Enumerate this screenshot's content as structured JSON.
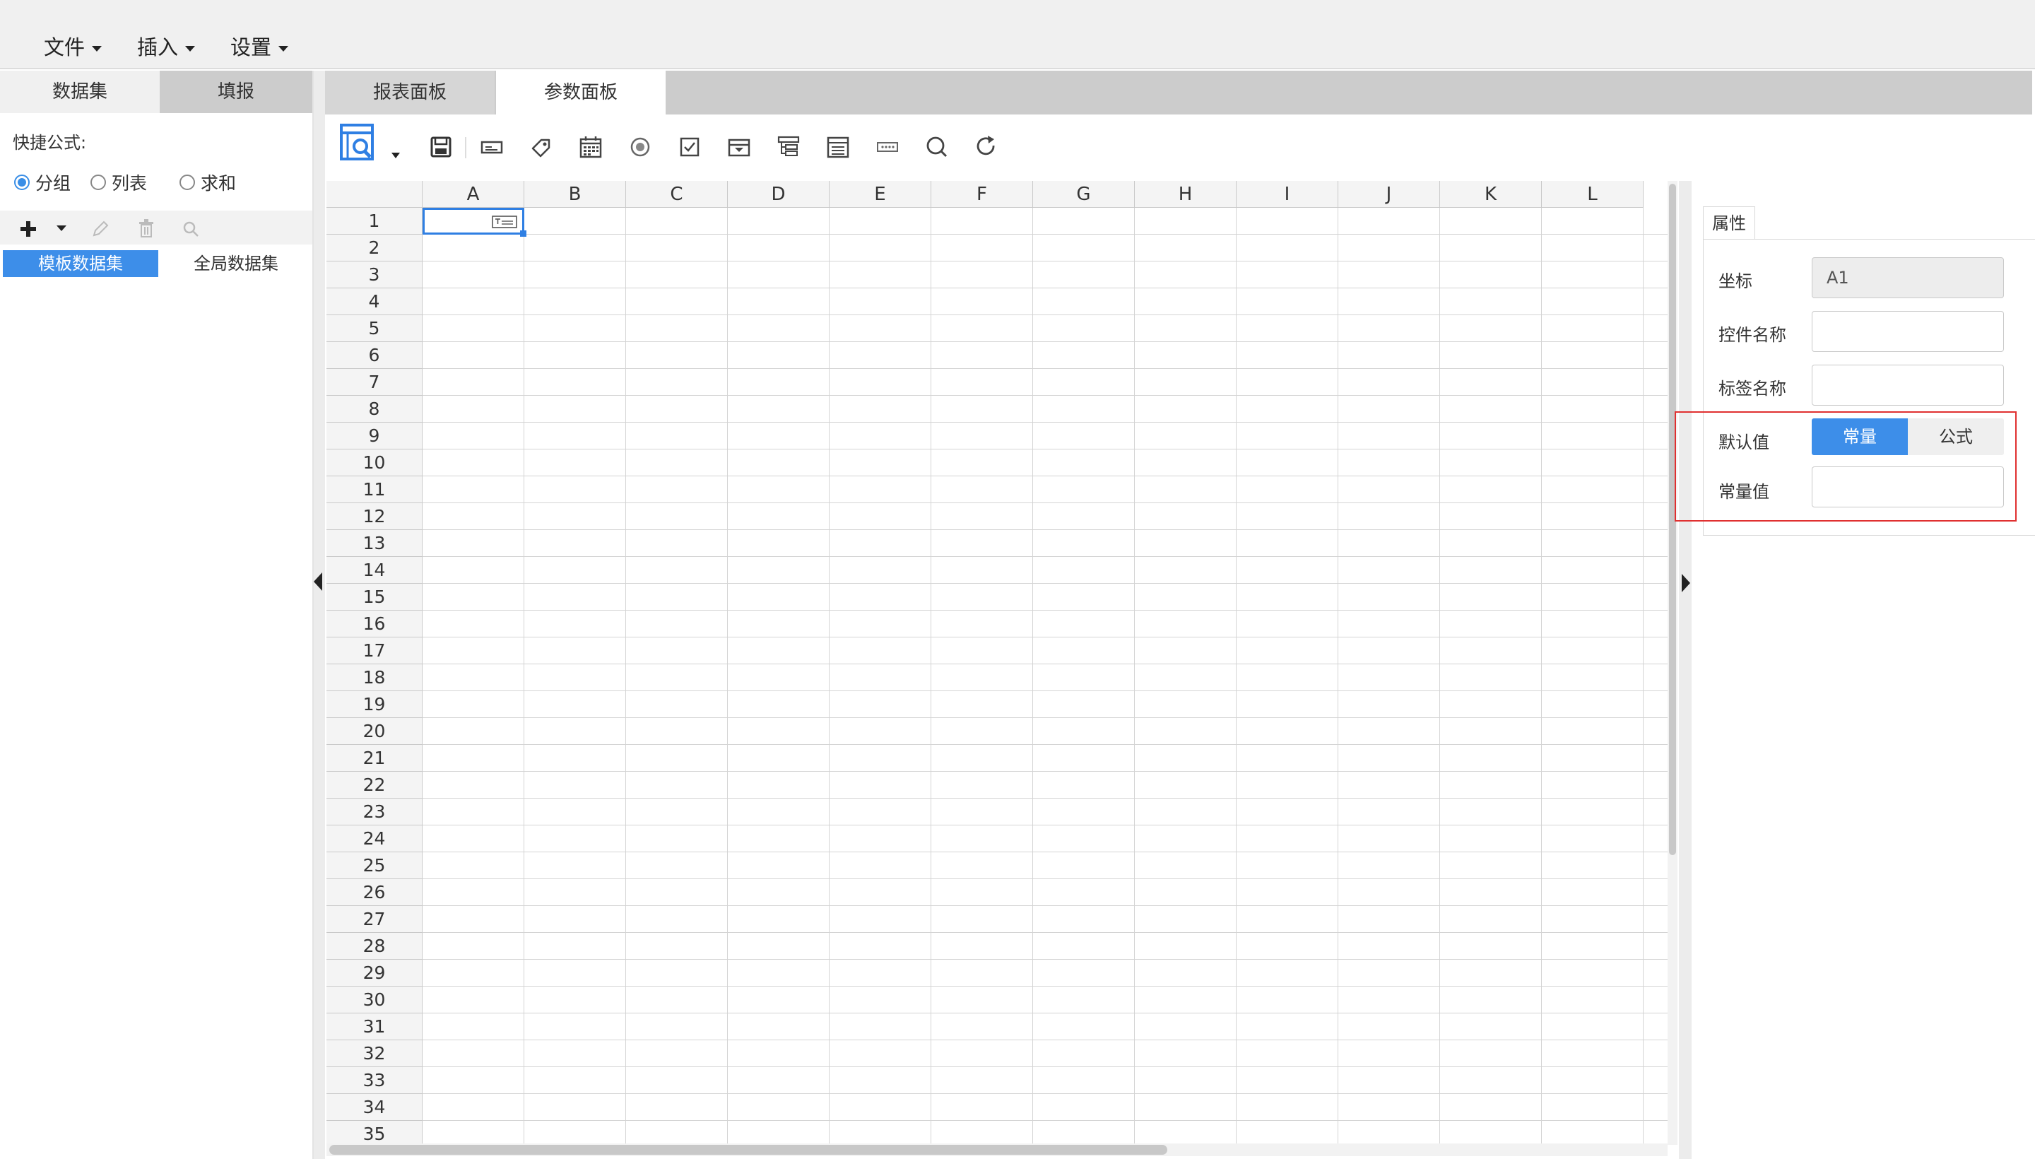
{
  "menu": {
    "items": [
      {
        "label": "文件"
      },
      {
        "label": "插入"
      },
      {
        "label": "设置"
      }
    ]
  },
  "left_panel": {
    "tabs": [
      {
        "label": "数据集"
      },
      {
        "label": "填报"
      }
    ],
    "quick_formula_label": "快捷公式:",
    "radios": [
      {
        "label": "分组",
        "selected": true
      },
      {
        "label": "列表",
        "selected": false
      },
      {
        "label": "求和",
        "selected": false
      }
    ],
    "dataset_tabs": [
      {
        "label": "模板数据集",
        "active": true
      },
      {
        "label": "全局数据集",
        "active": false
      }
    ]
  },
  "center_tabs": [
    {
      "label": "报表面板",
      "active": false
    },
    {
      "label": "参数面板",
      "active": true
    }
  ],
  "toolbar": {
    "icons": [
      "preview-search-icon",
      "save-icon",
      "text-control-icon",
      "label-tag-icon",
      "date-control-icon",
      "radio-control-icon",
      "checkbox-control-icon",
      "dropdown-control-icon",
      "tree-control-icon",
      "list-control-icon",
      "password-control-icon",
      "query-button-icon",
      "reset-icon"
    ]
  },
  "grid": {
    "columns": [
      "A",
      "B",
      "C",
      "D",
      "E",
      "F",
      "G",
      "H",
      "I",
      "J",
      "K",
      "L"
    ],
    "rows": [
      "1",
      "2",
      "3",
      "4",
      "5",
      "6",
      "7",
      "8",
      "9",
      "10",
      "11",
      "12",
      "13",
      "14",
      "15",
      "16",
      "17",
      "18",
      "19",
      "20",
      "21",
      "22",
      "23",
      "24",
      "25",
      "26",
      "27",
      "28",
      "29",
      "30",
      "31",
      "32",
      "33",
      "34",
      "35"
    ],
    "selected_cell": "A1",
    "accent": "#2f7fe3"
  },
  "properties": {
    "tab_label": "属性",
    "coord_label": "坐标",
    "coord_value": "A1",
    "control_name_label": "控件名称",
    "control_name_value": "",
    "tag_name_label": "标签名称",
    "tag_name_value": "",
    "default_label": "默认值",
    "default_options": [
      {
        "label": "常量",
        "active": true
      },
      {
        "label": "公式",
        "active": false
      }
    ],
    "const_label": "常量值",
    "const_value": "",
    "active_color": "#3d8ee9",
    "highlight_color": "#e03030"
  }
}
